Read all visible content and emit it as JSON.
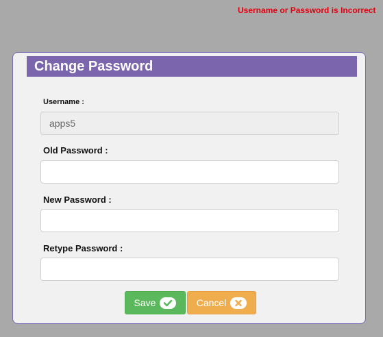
{
  "error_message": "Username or Password is Incorrect",
  "form": {
    "title": "Change Password",
    "username_label": "Username :",
    "username_value": "apps5",
    "old_password_label": "Old Password :",
    "old_password_value": "",
    "new_password_label": "New Password :",
    "new_password_value": "",
    "retype_password_label": "Retype Password :",
    "retype_password_value": ""
  },
  "buttons": {
    "save_label": "Save",
    "save_icon": "check-circle-icon",
    "cancel_label": "Cancel",
    "cancel_icon": "x-circle-icon"
  },
  "colors": {
    "error": "#e4000f",
    "header": "#7b66ad",
    "save": "#5cb85c",
    "cancel": "#f0ad4e",
    "background": "#a9a9a9"
  }
}
